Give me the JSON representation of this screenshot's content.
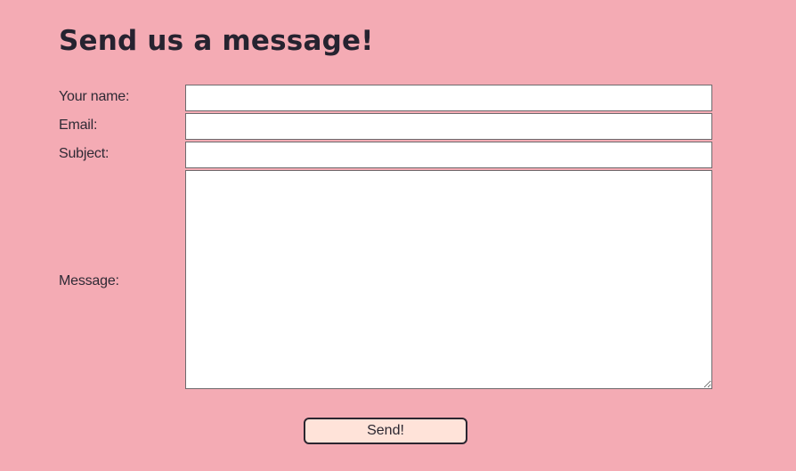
{
  "form": {
    "title": "Send us a message!",
    "fields": {
      "name": {
        "label": "Your name:",
        "value": "",
        "placeholder": ""
      },
      "email": {
        "label": "Email:",
        "value": "",
        "placeholder": ""
      },
      "subject": {
        "label": "Subject:",
        "value": "",
        "placeholder": ""
      },
      "message": {
        "label": "Message:",
        "value": "",
        "placeholder": ""
      }
    },
    "submit_label": "Send!"
  },
  "colors": {
    "background": "#f4abb4",
    "button_background": "#ffe3d9",
    "text": "#262330"
  }
}
